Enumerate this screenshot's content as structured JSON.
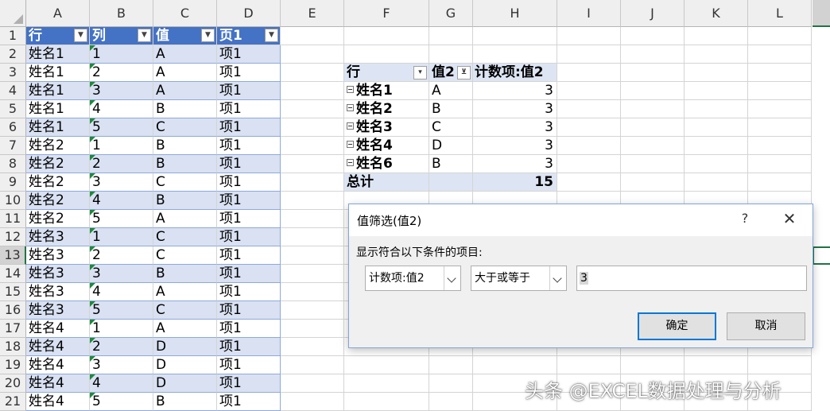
{
  "columns": [
    "A",
    "B",
    "C",
    "D",
    "E",
    "F",
    "G",
    "H",
    "I",
    "J",
    "K",
    "L"
  ],
  "rows": [
    "1",
    "2",
    "3",
    "4",
    "5",
    "6",
    "7",
    "8",
    "9",
    "10",
    "11",
    "12",
    "13",
    "14",
    "15",
    "16",
    "17",
    "18",
    "19",
    "20",
    "21"
  ],
  "source_table": {
    "headers": [
      "行",
      "列",
      "值",
      "页1"
    ],
    "rows": [
      [
        "姓名1",
        "1",
        "A",
        "项1"
      ],
      [
        "姓名1",
        "2",
        "A",
        "项1"
      ],
      [
        "姓名1",
        "3",
        "A",
        "项1"
      ],
      [
        "姓名1",
        "4",
        "B",
        "项1"
      ],
      [
        "姓名1",
        "5",
        "C",
        "项1"
      ],
      [
        "姓名2",
        "1",
        "B",
        "项1"
      ],
      [
        "姓名2",
        "2",
        "B",
        "项1"
      ],
      [
        "姓名2",
        "3",
        "C",
        "项1"
      ],
      [
        "姓名2",
        "4",
        "B",
        "项1"
      ],
      [
        "姓名2",
        "5",
        "A",
        "项1"
      ],
      [
        "姓名3",
        "1",
        "C",
        "项1"
      ],
      [
        "姓名3",
        "2",
        "C",
        "项1"
      ],
      [
        "姓名3",
        "3",
        "B",
        "项1"
      ],
      [
        "姓名3",
        "4",
        "A",
        "项1"
      ],
      [
        "姓名3",
        "5",
        "C",
        "项1"
      ],
      [
        "姓名4",
        "1",
        "A",
        "项1"
      ],
      [
        "姓名4",
        "2",
        "D",
        "项1"
      ],
      [
        "姓名4",
        "3",
        "D",
        "项1"
      ],
      [
        "姓名4",
        "4",
        "D",
        "项1"
      ],
      [
        "姓名4",
        "5",
        "B",
        "项1"
      ]
    ]
  },
  "pivot": {
    "headers": [
      "行",
      "值2",
      "计数项:值2"
    ],
    "rows": [
      [
        "姓名1",
        "A",
        "3"
      ],
      [
        "姓名2",
        "B",
        "3"
      ],
      [
        "姓名3",
        "C",
        "3"
      ],
      [
        "姓名4",
        "D",
        "3"
      ],
      [
        "姓名6",
        "B",
        "3"
      ]
    ],
    "total_label": "总计",
    "total_value": "15"
  },
  "dialog": {
    "title": "值筛选(值2)",
    "help": "?",
    "close": "✕",
    "prompt": "显示符合以下条件的项目:",
    "field_value": "计数项:值2",
    "operator_value": "大于或等于",
    "input_value": "3",
    "ok_label": "确定",
    "cancel_label": "取消"
  },
  "watermark": "头条 @EXCEL数据处理与分析",
  "colors": {
    "header_blue": "#4472c4",
    "band": "#d9e1f2",
    "excel_green": "#217346",
    "dialog_accent": "#0078d7"
  }
}
